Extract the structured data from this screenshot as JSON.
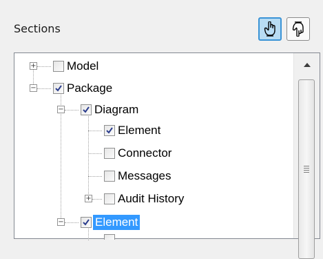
{
  "header": {
    "title": "Sections",
    "buttons": [
      {
        "icon": "hand-pointer-up-icon",
        "active": true
      },
      {
        "icon": "hand-pointer-down-icon",
        "active": false
      }
    ]
  },
  "tree": {
    "items": [
      {
        "label": "Model",
        "checked": false,
        "expander": "+",
        "selected": false
      },
      {
        "label": "Package",
        "checked": true,
        "expander": "−",
        "selected": false
      },
      {
        "label": "Diagram",
        "checked": true,
        "expander": "−",
        "selected": false
      },
      {
        "label": "Element",
        "checked": true,
        "expander": "",
        "selected": false
      },
      {
        "label": "Connector",
        "checked": false,
        "expander": "",
        "selected": false
      },
      {
        "label": "Messages",
        "checked": false,
        "expander": "",
        "selected": false
      },
      {
        "label": "Audit History",
        "checked": false,
        "expander": "+",
        "selected": false
      },
      {
        "label": "Element",
        "checked": true,
        "expander": "−",
        "selected": true
      }
    ]
  },
  "colors": {
    "selection": "#3399ff",
    "active_button_bg": "#b8dcf3",
    "active_button_border": "#3a93d6",
    "checkmark": "#2a3c8c"
  },
  "scrollbar": {
    "up_icon": "scroll-up-arrow-icon",
    "grip_icon": "scroll-grip-icon"
  }
}
